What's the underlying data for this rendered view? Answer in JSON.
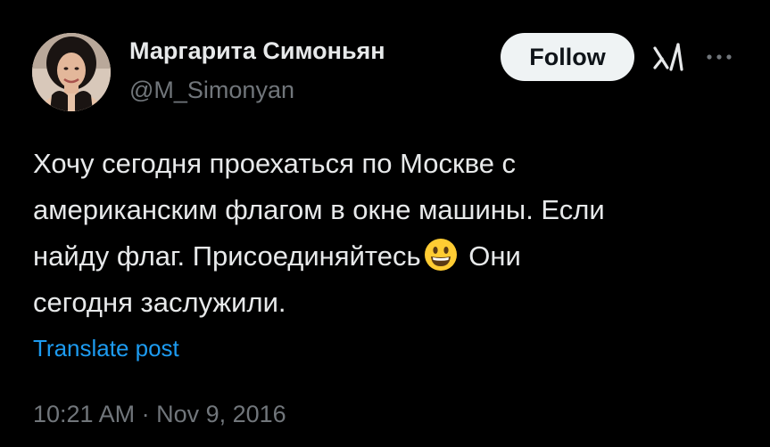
{
  "author": {
    "display_name": "Маргарита Симоньян",
    "handle": "@M_Simonyan"
  },
  "actions": {
    "follow_label": "Follow",
    "grok_icon": "grok-icon",
    "more_icon": "more-options-icon"
  },
  "tweet": {
    "lines": [
      "Хочу сегодня проехаться по Москве с",
      "американским флагом в окне машины. Если",
      "найду флаг. Присоединяйтесь",
      "Они",
      "сегодня заслужили."
    ],
    "emoji": "grinning-face-icon"
  },
  "translate_label": "Translate post",
  "timestamp": "10:21 AM · Nov 9, 2016",
  "colors": {
    "background": "#000000",
    "text": "#e7e9ea",
    "muted": "#71767b",
    "link": "#1d9bf0",
    "follow_bg": "#eff3f4"
  }
}
